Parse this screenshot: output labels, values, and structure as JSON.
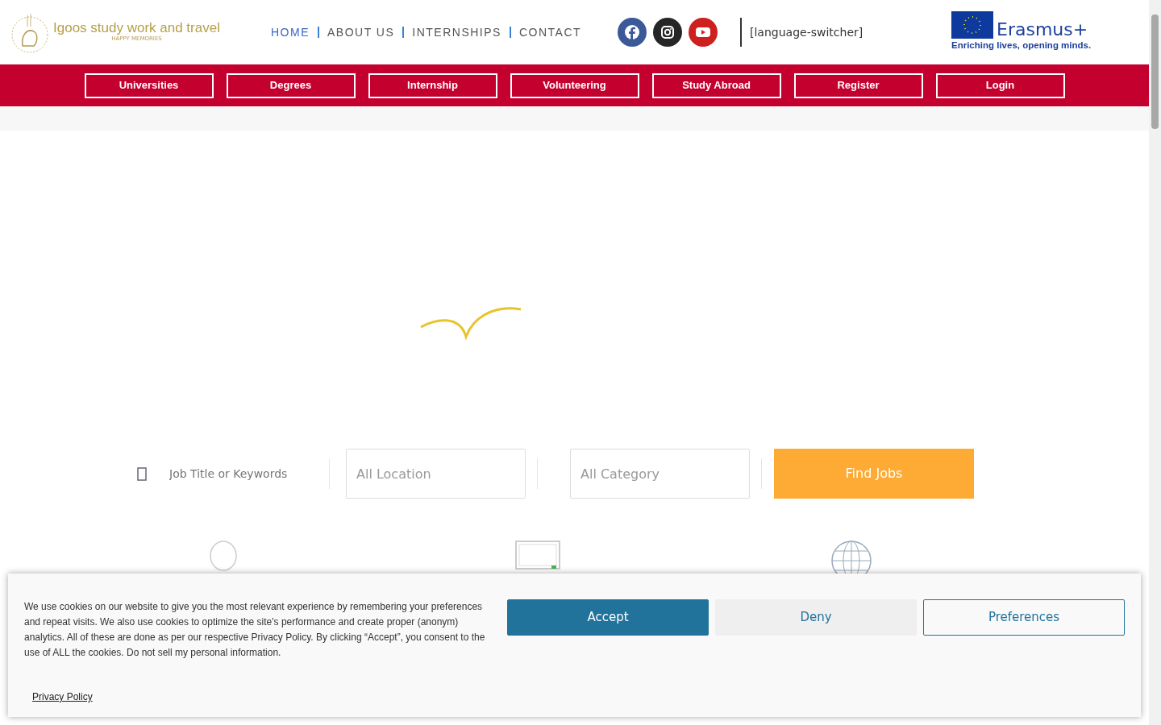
{
  "logo": {
    "title": "Igoos study work and travel",
    "tagline": "HAPPY MEMORIES"
  },
  "nav": [
    {
      "label": "HOME",
      "selected": true
    },
    {
      "label": "ABOUT US",
      "selected": false
    },
    {
      "label": "INTERNSHIPS",
      "selected": false
    },
    {
      "label": "CONTACT",
      "selected": false
    }
  ],
  "social": [
    {
      "kind": "facebook",
      "color": "#3b5998"
    },
    {
      "kind": "instagram",
      "color": "#262626"
    },
    {
      "kind": "youtube",
      "color": "#cd201f"
    }
  ],
  "language_switcher": "[language-switcher]",
  "erasmus": {
    "title": "Erasmus+",
    "slogan": "Enriching lives, opening minds."
  },
  "menu_buttons": [
    "Universities",
    "Degrees",
    "Internship",
    "Volunteering",
    "Study Abroad",
    "Register",
    "Login"
  ],
  "search": {
    "keyword_placeholder": "Job Title or Keywords",
    "location_placeholder": "All Location",
    "category_placeholder": "All Category",
    "button": "Find Jobs"
  },
  "features": [
    {
      "kind": "balloon"
    },
    {
      "kind": "monitor"
    },
    {
      "kind": "globe"
    }
  ],
  "cookie_banner": {
    "text": "We use cookies on our website to give you the most relevant experience by remembering your preferences and repeat visits. We also use cookies to optimize the site's performance and create proper (anonym) analytics. All of these are done as per our respective Privacy Policy. By clicking “Accept”, you consent to the use of ALL the cookies. Do not sell my personal information.",
    "link": "Privacy Policy",
    "buttons": [
      {
        "kind": "primary",
        "label": "Accept"
      },
      {
        "kind": "secondary",
        "label": "Deny"
      },
      {
        "kind": "outline",
        "label": "Preferences"
      }
    ]
  }
}
